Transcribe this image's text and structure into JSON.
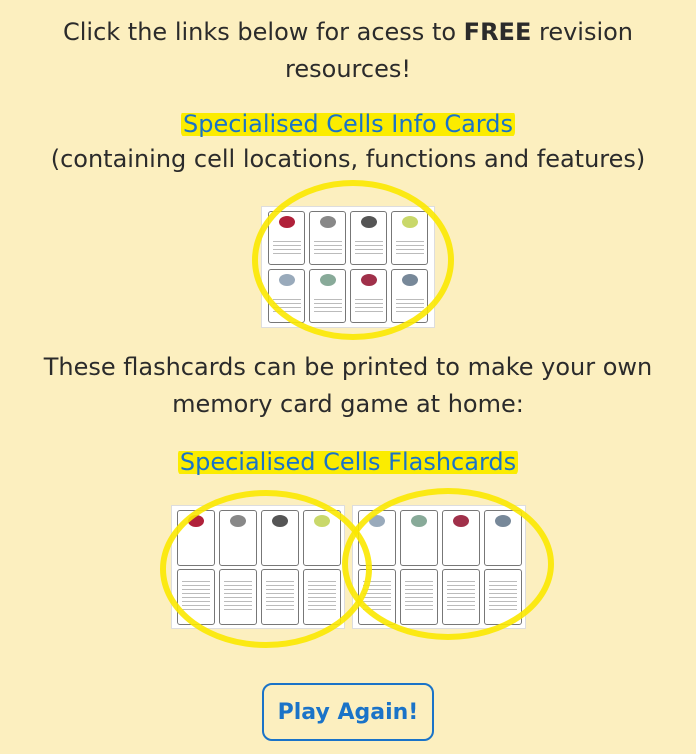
{
  "intro": {
    "line1_prefix": "Click the links below for acess to ",
    "line1_bold": "FREE",
    "line1_suffix": " revision",
    "line2": "resources!"
  },
  "info_cards": {
    "link_label": "Specialised Cells Info Cards",
    "description": "(containing cell locations, functions and features)"
  },
  "flashcards_intro": {
    "line1": "These flashcards can be printed to make your own",
    "line2": "memory card game at home:"
  },
  "flashcards": {
    "link_label": "Specialised Cells Flashcards"
  },
  "play_button": {
    "label": "Play Again!"
  },
  "colors": {
    "background": "#fcefbf",
    "link": "#1a73c8",
    "highlight": "#fbe800"
  }
}
